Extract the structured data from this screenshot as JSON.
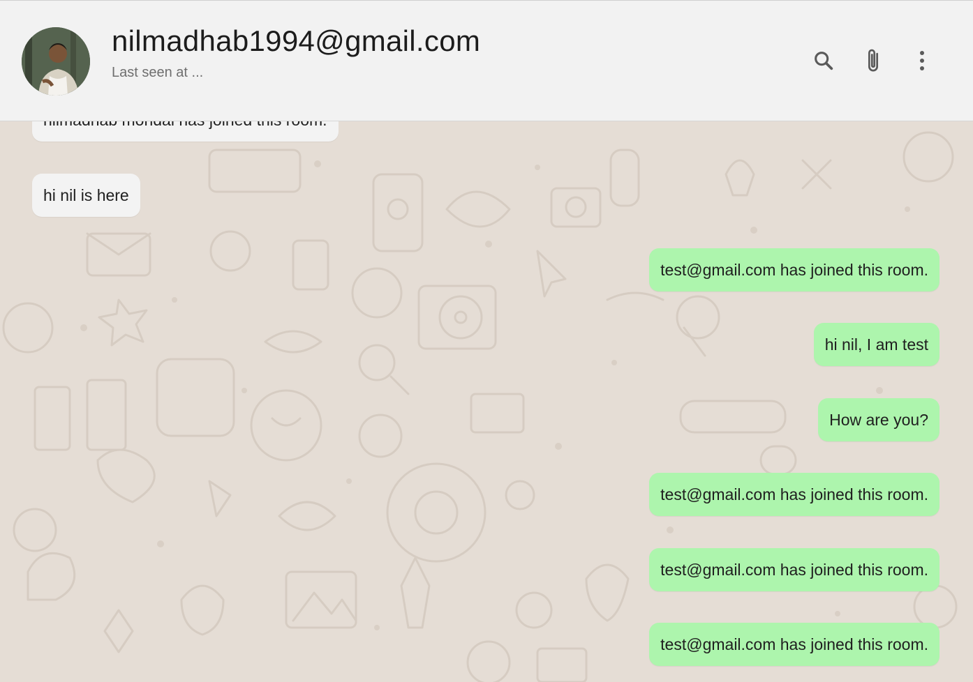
{
  "header": {
    "contact_name": "nilmadhab1994@gmail.com",
    "status": "Last seen at ...",
    "actions": {
      "search_icon": "search-icon",
      "attach_icon": "paperclip-icon",
      "menu_icon": "more-vertical-icon"
    }
  },
  "messages": [
    {
      "direction": "incoming",
      "text": "nilmadhab mondal has joined this room."
    },
    {
      "direction": "incoming",
      "text": "hi nil is here"
    },
    {
      "direction": "outgoing",
      "text": "test@gmail.com has joined this room."
    },
    {
      "direction": "outgoing",
      "text": "hi nil, I am test"
    },
    {
      "direction": "outgoing",
      "text": "How are you?"
    },
    {
      "direction": "outgoing",
      "text": "test@gmail.com has joined this room."
    },
    {
      "direction": "outgoing",
      "text": "test@gmail.com has joined this room."
    },
    {
      "direction": "outgoing",
      "text": "test@gmail.com has joined this room."
    }
  ],
  "colors": {
    "header_bg": "#f2f2f2",
    "chat_bg": "#e5ddd5",
    "incoming_bubble": "#f3f3f3",
    "outgoing_bubble": "#adf5ad",
    "icon": "#5a5a5a"
  }
}
